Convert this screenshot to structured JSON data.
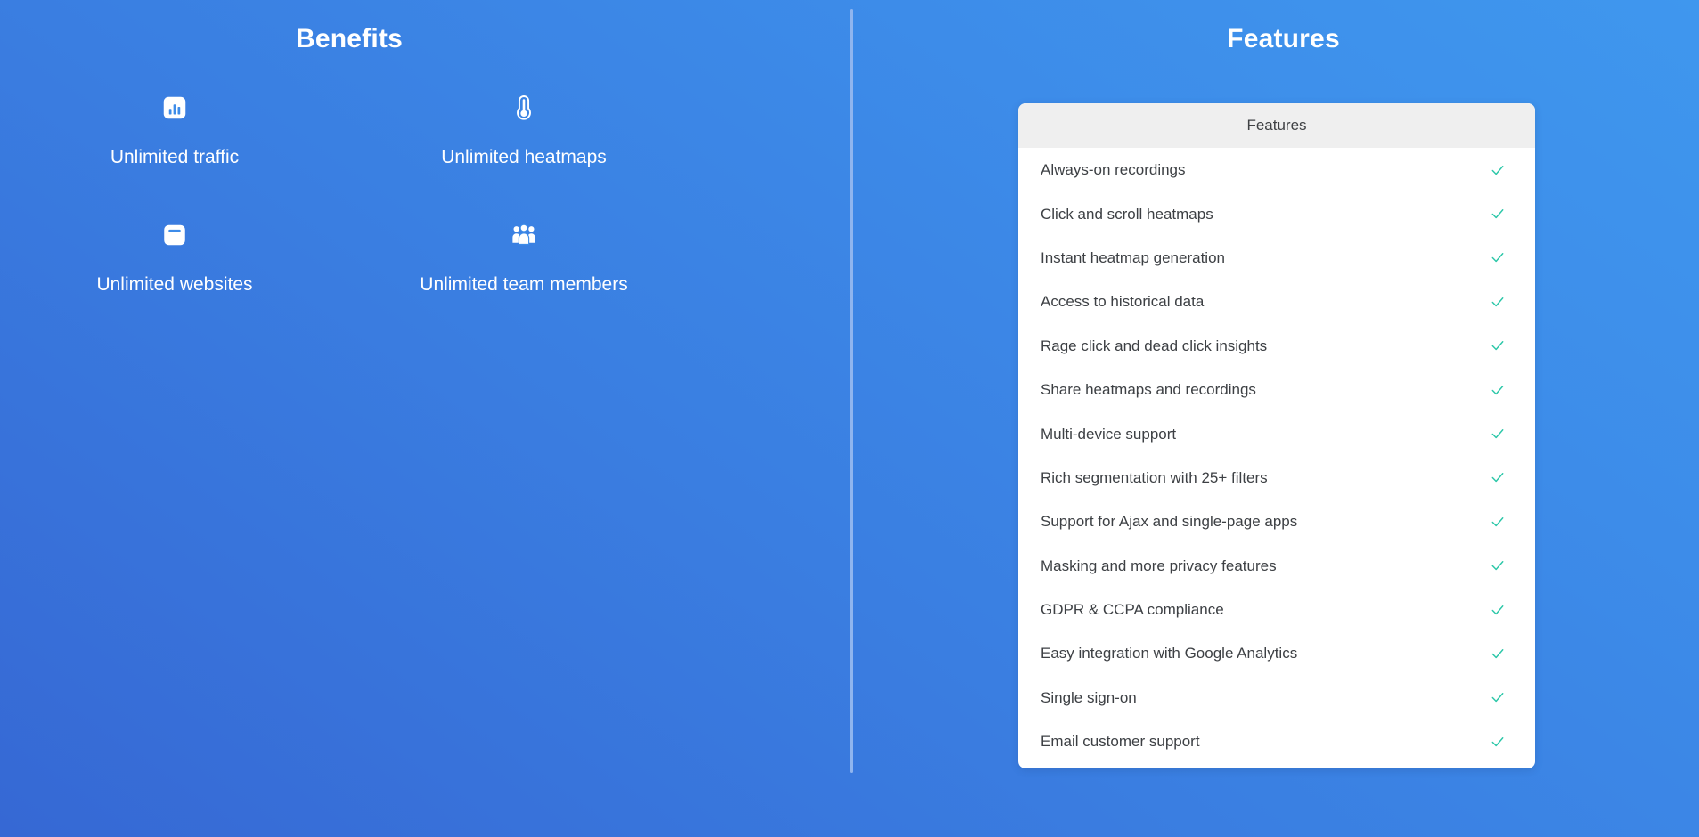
{
  "background": {
    "gradient_from": "#3f97ee",
    "gradient_to": "#3668d4"
  },
  "divider": {
    "color": "#8fb5ef"
  },
  "benefits": {
    "title": "Benefits",
    "items": [
      {
        "label": "Unlimited traffic",
        "icon": "bar-chart-icon"
      },
      {
        "label": "Unlimited heatmaps",
        "icon": "thermometer-icon"
      },
      {
        "label": "Unlimited websites",
        "icon": "browser-window-icon"
      },
      {
        "label": "Unlimited team members",
        "icon": "users-group-icon"
      }
    ]
  },
  "features": {
    "title": "Features",
    "table": {
      "column_header": "Features",
      "check_color": "#2cc7a8",
      "check_icon": "check-icon",
      "rows": [
        {
          "label": "Always-on recordings",
          "included": true
        },
        {
          "label": "Click and scroll heatmaps",
          "included": true
        },
        {
          "label": "Instant heatmap generation",
          "included": true
        },
        {
          "label": "Access to historical data",
          "included": true
        },
        {
          "label": "Rage click and dead click insights",
          "included": true
        },
        {
          "label": "Share heatmaps and recordings",
          "included": true
        },
        {
          "label": "Multi-device support",
          "included": true
        },
        {
          "label": "Rich segmentation with 25+ filters",
          "included": true
        },
        {
          "label": "Support for Ajax and single-page apps",
          "included": true
        },
        {
          "label": "Masking and more privacy features",
          "included": true
        },
        {
          "label": "GDPR & CCPA compliance",
          "included": true
        },
        {
          "label": "Easy integration with Google Analytics",
          "included": true
        },
        {
          "label": "Single sign-on",
          "included": true
        },
        {
          "label": "Email customer support",
          "included": true
        }
      ]
    }
  }
}
